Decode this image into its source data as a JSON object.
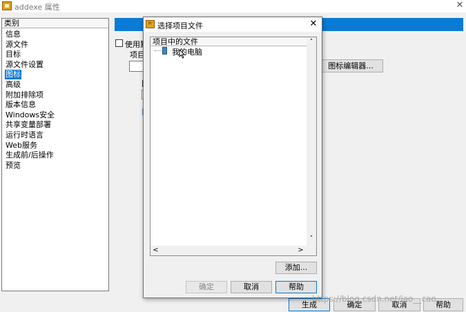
{
  "window": {
    "title": "addexe 属性",
    "close_glyph": "✕"
  },
  "category_list": {
    "header": "类别",
    "items": [
      "信息",
      "源文件",
      "目标",
      "源文件设置",
      "图标",
      "高级",
      "附加排除项",
      "版本信息",
      "Windows安全",
      "共享变量部署",
      "运行时语言",
      "Web服务",
      "生成前/后操作",
      "预览"
    ],
    "selected_index": 4
  },
  "right_panel": {
    "use_default_label": "使用默",
    "project_label": "项目",
    "icon_editor_button": "图标编辑器..."
  },
  "main_buttons": {
    "build": "生成",
    "ok": "确定",
    "cancel": "取消",
    "help": "帮助"
  },
  "dialog": {
    "title": "选择项目文件",
    "close_glyph": "✕",
    "icon_text": "Pr",
    "tree_header": "项目中的文件",
    "tree_items": [
      {
        "label": "我的电脑",
        "icon": "computer-icon"
      }
    ],
    "add_button": "添加...",
    "ok_button": "确定",
    "cancel_button": "取消",
    "help_button": "帮助",
    "scroll_up": "˄",
    "scroll_down": "˅",
    "scroll_left": "<",
    "scroll_right": ">"
  },
  "watermark": "https://blog.csdn.net/lao__cao",
  "colors": {
    "selection": "#0078d7",
    "header_bar": "#0a7cd6",
    "ok_disabled_text": "#8a8a8a"
  }
}
